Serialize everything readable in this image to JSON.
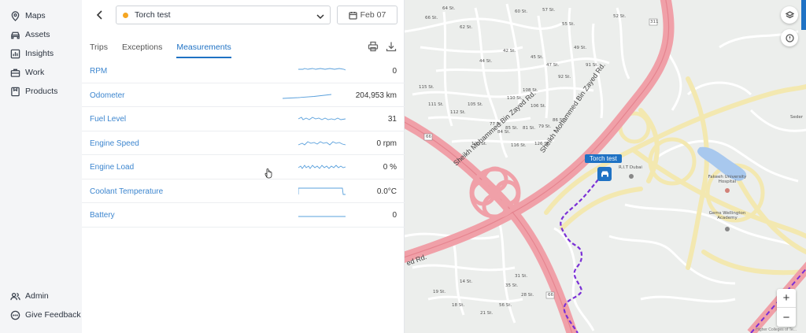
{
  "sidebar": {
    "items": [
      {
        "label": "Maps",
        "icon": "map-pin-icon"
      },
      {
        "label": "Assets",
        "icon": "car-icon"
      },
      {
        "label": "Insights",
        "icon": "chart-icon"
      },
      {
        "label": "Work",
        "icon": "briefcase-icon"
      },
      {
        "label": "Products",
        "icon": "box-icon"
      }
    ],
    "bottom_items": [
      {
        "label": "Admin",
        "icon": "users-icon"
      },
      {
        "label": "Give Feedback",
        "icon": "feedback-icon"
      }
    ]
  },
  "header": {
    "vehicle_name": "Torch test",
    "status_color": "#f5a623",
    "date_label": "Feb 07"
  },
  "tabs": [
    {
      "label": "Trips",
      "active": false
    },
    {
      "label": "Exceptions",
      "active": false
    },
    {
      "label": "Measurements",
      "active": true
    }
  ],
  "measurements": [
    {
      "label": "RPM",
      "value": "0"
    },
    {
      "label": "Odometer",
      "value": "204,953 km"
    },
    {
      "label": "Fuel Level",
      "value": "31"
    },
    {
      "label": "Engine Speed",
      "value": "0 rpm"
    },
    {
      "label": "Engine Load",
      "value": "0 %"
    },
    {
      "label": "Coolant Temperature",
      "value": "0.0°C"
    },
    {
      "label": "Battery",
      "value": "0"
    }
  ],
  "map": {
    "vehicle_label": "Torch test",
    "roads": {
      "main_road_1": "Sheikh Mohammed Bin Zayed Rd.",
      "main_road_2": "Sheikh Mohammed Bin Zayed Rd.",
      "main_road_3": "ed Rd."
    },
    "places": {
      "rit": "R.I.T Dubai",
      "hospital": "Fakeeh University Hospital",
      "academy": "Gems Wellington Academy",
      "seder": "Seder"
    },
    "street_labels": [
      "66 St.",
      "64 St.",
      "62 St.",
      "60 St.",
      "57 St.",
      "55 St.",
      "52 St.",
      "42 St.",
      "44 St.",
      "45 St.",
      "47 St.",
      "49 St.",
      "92 St.",
      "91 St.",
      "115 St.",
      "111 St.",
      "112 St.",
      "105 St.",
      "108 St.",
      "106 St.",
      "110 St.",
      "120 St.",
      "116 St.",
      "126 St.",
      "77 St.",
      "84 St.",
      "85 St.",
      "79 St.",
      "86 St.",
      "81 St.",
      "14 St.",
      "19 St.",
      "18 St.",
      "21 St.",
      "35 St.",
      "31 St.",
      "28 St.",
      "56 St."
    ],
    "shields": [
      "311",
      "66",
      "66"
    ],
    "accent": "#1f72c4",
    "route_color": "#7a2fd6",
    "highway_color": "#f0a0a8"
  },
  "map_controls": {
    "zoom_in": "+",
    "zoom_out": "−",
    "layers_icon": "layers-icon",
    "info_icon": "info-icon"
  },
  "attribution": "Higher Colleges of Te..."
}
